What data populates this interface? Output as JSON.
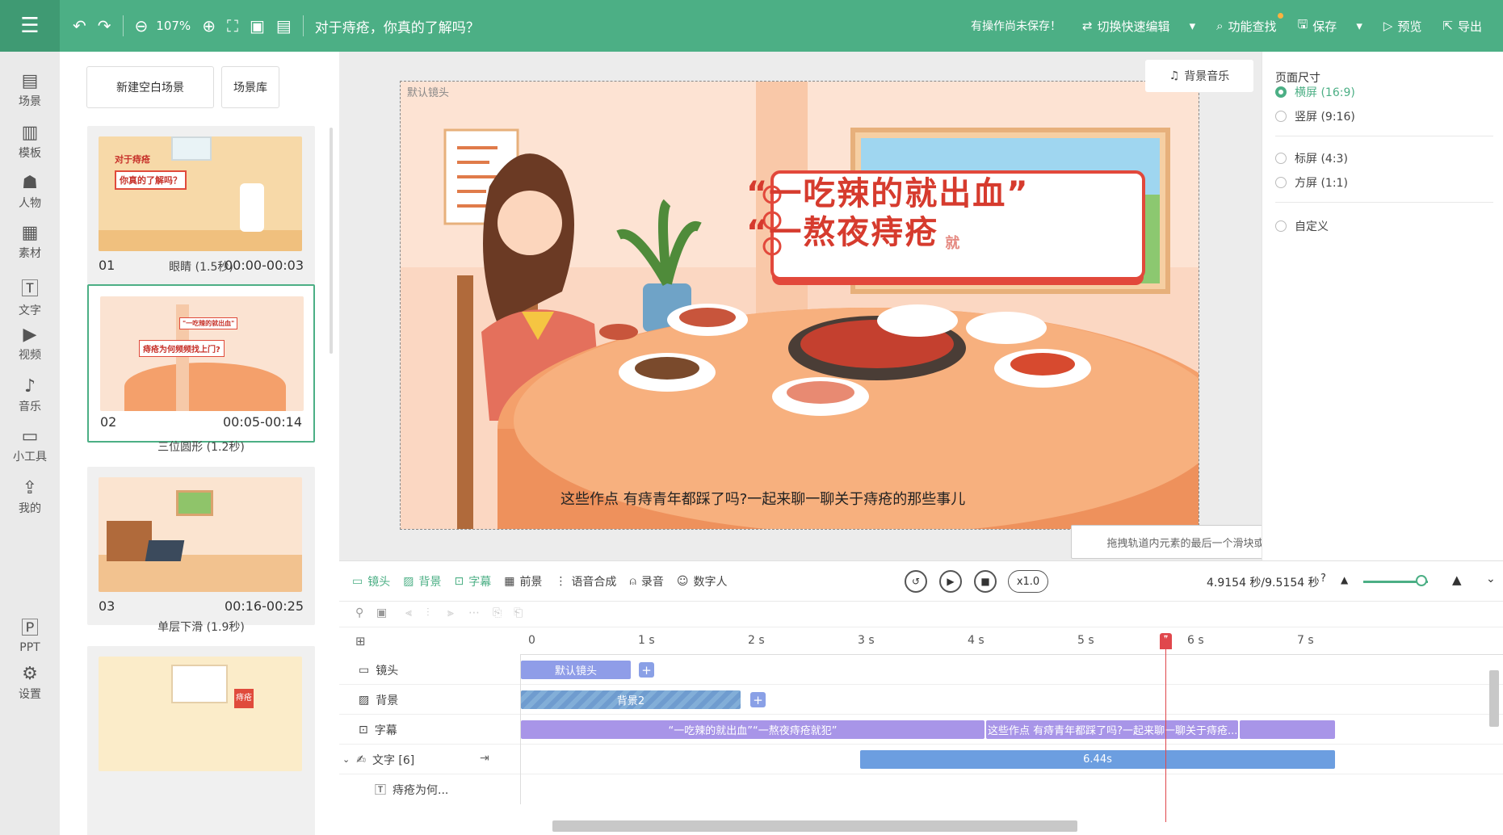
{
  "toolbar": {
    "zoom": "107%",
    "doc_title": "对于痔疮，你真的了解吗？",
    "unsaved_msg": "有操作尚未保存！",
    "quick_edit": "切换快速编辑",
    "feature_search": "功能查找",
    "save": "保存",
    "preview": "预览",
    "export": "导出"
  },
  "nav": [
    "场景",
    "模板",
    "人物",
    "素材",
    "文字",
    "视频",
    "音乐",
    "小工具",
    "我的",
    "PPT",
    "设置"
  ],
  "scenes": {
    "new_blank": "新建空白场景",
    "library": "场景库",
    "items": [
      {
        "num": "01",
        "time": "00:00-00:03",
        "transition": "眼睛 (1.5秒)"
      },
      {
        "num": "02",
        "time": "00:05-00:14",
        "transition": "三位圆形 (1.2秒)"
      },
      {
        "num": "03",
        "time": "00:16-00:25",
        "transition": "单层下滑 (1.9秒)"
      }
    ],
    "thumb1_line1": "对于痔疮",
    "thumb1_line2": "你真的了解吗？",
    "thumb2_line1": "\"一吃辣的就出血\"",
    "thumb2_line2": "痔疮为何频频找上门?",
    "thumb4_text": "痔疮为何..."
  },
  "stage": {
    "camera_label": "默认镜头",
    "bg_music": "背景音乐",
    "bubble_line1": "“一吃辣的就出血”",
    "bubble_line2": "“一熬夜痔疮",
    "bubble_small": "就",
    "subtitle": "这些作点 有痔青年都踩了吗?一起来聊一聊关于痔疮的那些事儿"
  },
  "tip": "拖拽轨道内元素的最后一个滑块或刻度尺末端滑块可增加或减少总时间",
  "right_panel": {
    "title": "页面尺寸",
    "options": [
      "横屏 (16:9)",
      "竖屏 (9:16)",
      "标屏 (4:3)",
      "方屏 (1:1)",
      "自定义"
    ],
    "selected": 0
  },
  "timeline": {
    "tabs": [
      "镜头",
      "背景",
      "字幕",
      "前景",
      "语音合成",
      "录音",
      "数字人"
    ],
    "speed": "x1.0",
    "time_readout": "4.9154 秒/9.5154 秒",
    "ruler": [
      "0",
      "1 s",
      "2 s",
      "3 s",
      "4 s",
      "5 s",
      "6 s",
      "7 s"
    ],
    "rows": [
      {
        "name": "镜头",
        "clip": "默认镜头"
      },
      {
        "name": "背景",
        "clip": "背景2"
      },
      {
        "name": "字幕",
        "clip1": "“一吃辣的就出血”“一熬夜痔疮就犯”",
        "clip2": "这些作点 有痔青年都踩了吗?一起来聊一聊关于痔疮..."
      },
      {
        "name": "文字 [6]",
        "clip": "6.44s"
      },
      {
        "name": "痔疮为何..."
      }
    ]
  }
}
